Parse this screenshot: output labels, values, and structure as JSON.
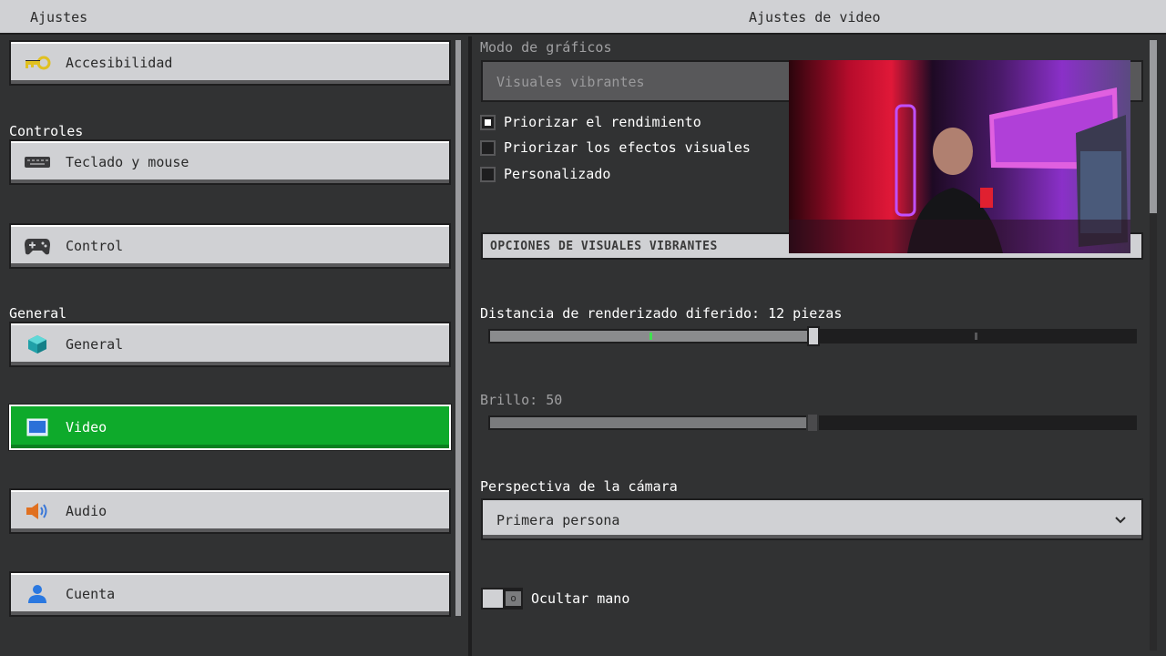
{
  "header": {
    "left_title": "Ajustes",
    "right_title": "Ajustes de video"
  },
  "sidebar": {
    "sections": {
      "controles": "Controles",
      "general": "General"
    },
    "items": [
      {
        "label": "Accesibilidad",
        "icon": "key-icon"
      },
      {
        "label": "Teclado y mouse",
        "icon": "keyboard-icon"
      },
      {
        "label": "Control",
        "icon": "gamepad-icon"
      },
      {
        "label": "General",
        "icon": "cube-icon"
      },
      {
        "label": "Video",
        "icon": "monitor-icon",
        "active": true
      },
      {
        "label": "Audio",
        "icon": "speaker-icon"
      },
      {
        "label": "Cuenta",
        "icon": "person-icon"
      }
    ]
  },
  "video": {
    "graphics_mode_label": "Modo de gráficos",
    "graphics_mode_value": "Visuales vibrantes",
    "options": [
      {
        "label": "Priorizar el rendimiento",
        "checked": true
      },
      {
        "label": "Priorizar los efectos visuales",
        "checked": false
      },
      {
        "label": "Personalizado",
        "checked": false
      }
    ],
    "section_header": "OPCIONES DE VISUALES VIBRANTES",
    "render_distance_label": "Distancia de renderizado diferido: 12 piezas",
    "render_distance_fraction": 0.5,
    "brightness_label": "Brillo: 50",
    "brightness_fraction": 0.5,
    "perspective_label": "Perspectiva de la cámara",
    "perspective_value": "Primera persona",
    "hide_hand_label": "Ocultar mano",
    "hide_hand_on": false
  },
  "colors": {
    "accent": "#0eaa2b",
    "panel": "#d0d1d4",
    "background": "#313233"
  }
}
